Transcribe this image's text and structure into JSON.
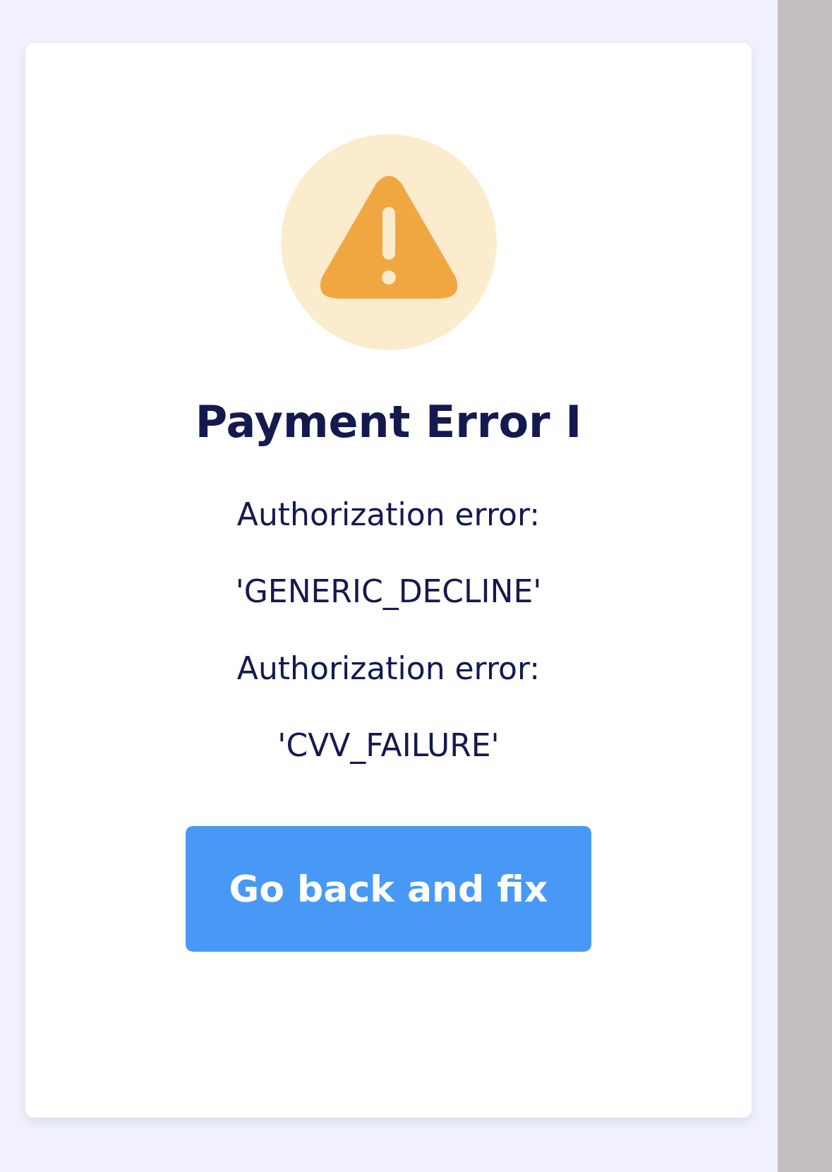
{
  "dialog": {
    "title": "Payment Error I",
    "messages": [
      "Authorization error:",
      "'GENERIC_DECLINE'",
      "Authorization error:",
      "'CVV_FAILURE'"
    ],
    "button": {
      "label": "Go back and fix"
    }
  }
}
